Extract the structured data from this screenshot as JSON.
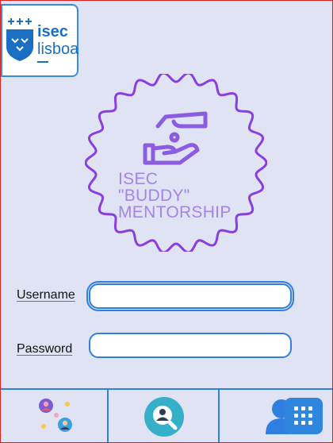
{
  "logo": {
    "name_top": "isec",
    "name_bottom": "lisboa"
  },
  "emblem": {
    "lines": [
      "ISEC",
      "\"BUDDY\"",
      "MENTORSHIP"
    ]
  },
  "form": {
    "username_label": "Username",
    "username_value": "",
    "password_label": "Password",
    "password_value": ""
  },
  "colors": {
    "accent": "#2f7fe0",
    "emblem_purple": "#8a3ee0",
    "background": "#dfe3f3"
  },
  "nav": {
    "icons": [
      "people-network-icon",
      "search-user-icon",
      "users-icon"
    ],
    "fab_icon": "grid-icon"
  }
}
